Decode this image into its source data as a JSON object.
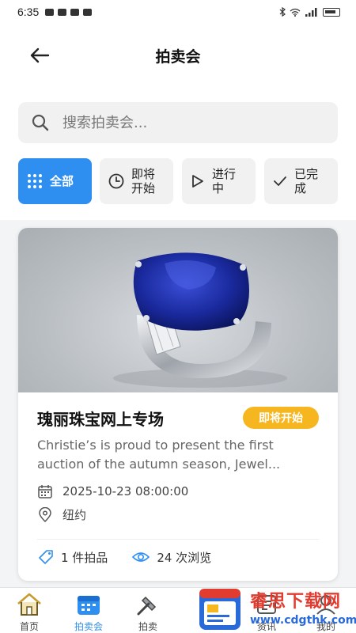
{
  "status_bar": {
    "time": "6:35"
  },
  "header": {
    "title": "拍卖会"
  },
  "search": {
    "placeholder": "搜索拍卖会..."
  },
  "filters": [
    {
      "label": "全部",
      "icon": "grid-icon",
      "active": true
    },
    {
      "label": "即将\n开始",
      "icon": "clock-icon",
      "active": false
    },
    {
      "label": "进行\n中",
      "icon": "play-icon",
      "active": false
    },
    {
      "label": "已完\n成",
      "icon": "check-icon",
      "active": false
    }
  ],
  "card": {
    "title": "瑰丽珠宝网上专场",
    "badge": "即将开始",
    "description": "Christie’s is proud to present the first auction of the autumn season, Jewel...",
    "date": "2025-10-23 08:00:00",
    "location": "纽约",
    "lots": "1 件拍品",
    "views": "24 次浏览"
  },
  "bottom_nav": [
    {
      "label": "首页",
      "icon": "home-icon"
    },
    {
      "label": "拍卖会",
      "icon": "calendar-icon",
      "active": true
    },
    {
      "label": "拍卖",
      "icon": "hammer-icon"
    },
    {
      "label": "资讯",
      "icon": "news-icon"
    },
    {
      "label": "我的",
      "icon": "user-icon"
    }
  ],
  "watermark": {
    "name": "睿思下载网",
    "url": "www.cdgthk.com"
  },
  "colors": {
    "accent": "#2f8ff0",
    "badge": "#f6b620",
    "watermark_red": "#e23b2f",
    "watermark_blue": "#2a6ad8"
  }
}
